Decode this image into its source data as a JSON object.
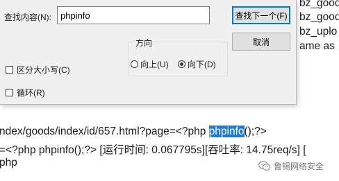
{
  "background_text": {
    "right_lines": [
      "bz_good",
      "bz_good",
      "bz_uplo",
      "ame as"
    ],
    "line1_before": "ndex/goods/index/id/657.html?page=<?php ",
    "line1_highlight": "phpinfo",
    "line1_after": "();?>",
    "line2": "=<?php phpinfo();?> [运行时间: 0.067795s][吞吐率: 14.75req/s] [",
    "line3": "php"
  },
  "dialog": {
    "find_label": "查找内容(N):",
    "find_value": "phpinfo",
    "find_next_label": "查找下一个(F)",
    "cancel_label": "取消",
    "direction_label": "方向",
    "up_label": "向上(U)",
    "down_label": "向下(D)",
    "selected_direction": "down",
    "match_case_label": "区分大小写(C)",
    "match_case_checked": false,
    "wrap_label": "循环(R)",
    "wrap_checked": false,
    "accent_color": "#0078d7"
  },
  "watermark": {
    "text": "鲁锡网络安全",
    "icon": "wechat-icon"
  }
}
